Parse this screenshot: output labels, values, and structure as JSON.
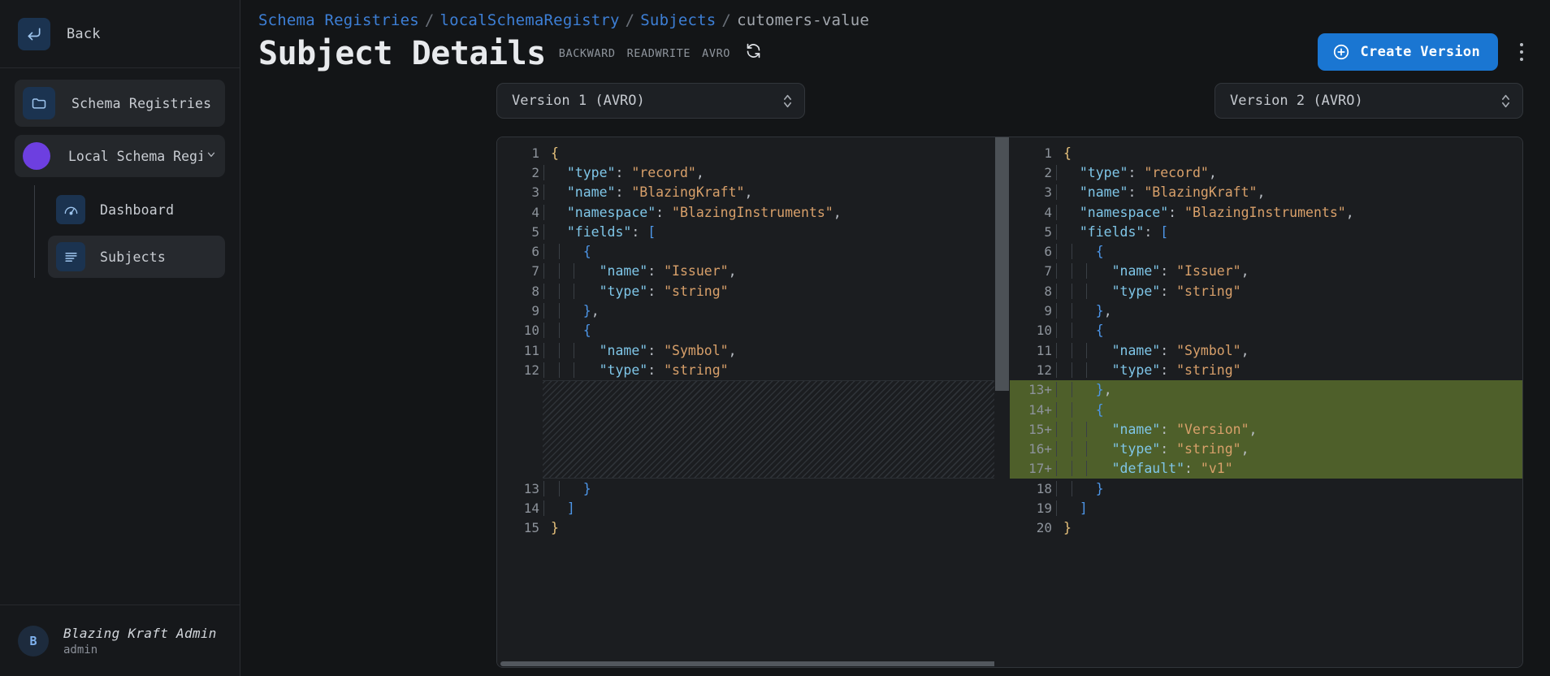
{
  "colors": {
    "accent": "#1a76d2",
    "link": "#3d7fd6",
    "diff_added_bg": "#4e5f2a",
    "registry_dot": "#6d3fe0"
  },
  "sidebar": {
    "back": {
      "label": "Back",
      "icon": "back-arrow-icon"
    },
    "schema_registries": {
      "label": "Schema Registries",
      "icon": "folder-icon"
    },
    "registry": {
      "label": "Local Schema Regi…",
      "icon": "registry-dot-icon",
      "chevron": "⌄"
    },
    "nav": [
      {
        "label": "Dashboard",
        "icon": "gauge-icon",
        "active": false
      },
      {
        "label": "Subjects",
        "icon": "list-icon",
        "active": true
      }
    ],
    "user": {
      "initial": "B",
      "name": "Blazing Kraft Admin",
      "role": "admin"
    }
  },
  "header": {
    "breadcrumb": [
      {
        "text": "Schema Registries",
        "type": "link"
      },
      {
        "text": "localSchemaRegistry",
        "type": "link"
      },
      {
        "text": "Subjects",
        "type": "link"
      },
      {
        "text": "cutomers-value",
        "type": "current"
      }
    ],
    "breadcrumb_separator": "/",
    "title": "Subject Details",
    "badges": [
      "BACKWARD",
      "READWRITE",
      "AVRO"
    ],
    "refresh_icon": "refresh-icon",
    "create_button": {
      "label": "Create Version",
      "icon": "plus-circle-icon"
    },
    "kebab_icon": "more-vertical-icon"
  },
  "version_selects": {
    "left": {
      "value": "Version 1 (AVRO)",
      "icon": "chevron-updown-icon"
    },
    "right": {
      "value": "Version 2 (AVRO)",
      "icon": "chevron-updown-icon"
    }
  },
  "diff": {
    "left": {
      "lines": [
        {
          "n": "1",
          "added": false,
          "indent": 0,
          "tokens": [
            [
              "brace",
              "{"
            ]
          ]
        },
        {
          "n": "2",
          "added": false,
          "indent": 1,
          "tokens": [
            [
              "key",
              "\"type\""
            ],
            [
              "punct",
              ": "
            ],
            [
              "str",
              "\"record\""
            ],
            [
              "punct",
              ","
            ]
          ]
        },
        {
          "n": "3",
          "added": false,
          "indent": 1,
          "tokens": [
            [
              "key",
              "\"name\""
            ],
            [
              "punct",
              ": "
            ],
            [
              "str",
              "\"BlazingKraft\""
            ],
            [
              "punct",
              ","
            ]
          ]
        },
        {
          "n": "4",
          "added": false,
          "indent": 1,
          "tokens": [
            [
              "key",
              "\"namespace\""
            ],
            [
              "punct",
              ": "
            ],
            [
              "str",
              "\"BlazingInstruments\""
            ],
            [
              "punct",
              ","
            ]
          ]
        },
        {
          "n": "5",
          "added": false,
          "indent": 1,
          "tokens": [
            [
              "key",
              "\"fields\""
            ],
            [
              "punct",
              ": "
            ],
            [
              "brace2",
              "["
            ]
          ]
        },
        {
          "n": "6",
          "added": false,
          "indent": 2,
          "tokens": [
            [
              "brace2",
              "{"
            ]
          ]
        },
        {
          "n": "7",
          "added": false,
          "indent": 3,
          "tokens": [
            [
              "key",
              "\"name\""
            ],
            [
              "punct",
              ": "
            ],
            [
              "str",
              "\"Issuer\""
            ],
            [
              "punct",
              ","
            ]
          ]
        },
        {
          "n": "8",
          "added": false,
          "indent": 3,
          "tokens": [
            [
              "key",
              "\"type\""
            ],
            [
              "punct",
              ": "
            ],
            [
              "str",
              "\"string\""
            ]
          ]
        },
        {
          "n": "9",
          "added": false,
          "indent": 2,
          "tokens": [
            [
              "brace2",
              "}"
            ],
            [
              "punct",
              ","
            ]
          ]
        },
        {
          "n": "10",
          "added": false,
          "indent": 2,
          "tokens": [
            [
              "brace2",
              "{"
            ]
          ]
        },
        {
          "n": "11",
          "added": false,
          "indent": 3,
          "tokens": [
            [
              "key",
              "\"name\""
            ],
            [
              "punct",
              ": "
            ],
            [
              "str",
              "\"Symbol\""
            ],
            [
              "punct",
              ","
            ]
          ]
        },
        {
          "n": "12",
          "added": false,
          "indent": 3,
          "tokens": [
            [
              "key",
              "\"type\""
            ],
            [
              "punct",
              ": "
            ],
            [
              "str",
              "\"string\""
            ]
          ]
        },
        {
          "n": "",
          "added": false,
          "indent": 0,
          "tokens": [],
          "filler": true
        },
        {
          "n": "",
          "added": false,
          "indent": 0,
          "tokens": [],
          "filler": true
        },
        {
          "n": "",
          "added": false,
          "indent": 0,
          "tokens": [],
          "filler": true
        },
        {
          "n": "",
          "added": false,
          "indent": 0,
          "tokens": [],
          "filler": true
        },
        {
          "n": "",
          "added": false,
          "indent": 0,
          "tokens": [],
          "filler": true
        },
        {
          "n": "13",
          "added": false,
          "indent": 2,
          "tokens": [
            [
              "brace2",
              "}"
            ]
          ]
        },
        {
          "n": "14",
          "added": false,
          "indent": 1,
          "tokens": [
            [
              "brace2",
              "]"
            ]
          ]
        },
        {
          "n": "15",
          "added": false,
          "indent": 0,
          "tokens": [
            [
              "brace",
              "}"
            ]
          ]
        }
      ]
    },
    "right": {
      "lines": [
        {
          "n": "1",
          "added": false,
          "indent": 0,
          "tokens": [
            [
              "brace",
              "{"
            ]
          ]
        },
        {
          "n": "2",
          "added": false,
          "indent": 1,
          "tokens": [
            [
              "key",
              "\"type\""
            ],
            [
              "punct",
              ": "
            ],
            [
              "str",
              "\"record\""
            ],
            [
              "punct",
              ","
            ]
          ]
        },
        {
          "n": "3",
          "added": false,
          "indent": 1,
          "tokens": [
            [
              "key",
              "\"name\""
            ],
            [
              "punct",
              ": "
            ],
            [
              "str",
              "\"BlazingKraft\""
            ],
            [
              "punct",
              ","
            ]
          ]
        },
        {
          "n": "4",
          "added": false,
          "indent": 1,
          "tokens": [
            [
              "key",
              "\"namespace\""
            ],
            [
              "punct",
              ": "
            ],
            [
              "str",
              "\"BlazingInstruments\""
            ],
            [
              "punct",
              ","
            ]
          ]
        },
        {
          "n": "5",
          "added": false,
          "indent": 1,
          "tokens": [
            [
              "key",
              "\"fields\""
            ],
            [
              "punct",
              ": "
            ],
            [
              "brace2",
              "["
            ]
          ]
        },
        {
          "n": "6",
          "added": false,
          "indent": 2,
          "tokens": [
            [
              "brace2",
              "{"
            ]
          ]
        },
        {
          "n": "7",
          "added": false,
          "indent": 3,
          "tokens": [
            [
              "key",
              "\"name\""
            ],
            [
              "punct",
              ": "
            ],
            [
              "str",
              "\"Issuer\""
            ],
            [
              "punct",
              ","
            ]
          ]
        },
        {
          "n": "8",
          "added": false,
          "indent": 3,
          "tokens": [
            [
              "key",
              "\"type\""
            ],
            [
              "punct",
              ": "
            ],
            [
              "str",
              "\"string\""
            ]
          ]
        },
        {
          "n": "9",
          "added": false,
          "indent": 2,
          "tokens": [
            [
              "brace2",
              "}"
            ],
            [
              "punct",
              ","
            ]
          ]
        },
        {
          "n": "10",
          "added": false,
          "indent": 2,
          "tokens": [
            [
              "brace2",
              "{"
            ]
          ]
        },
        {
          "n": "11",
          "added": false,
          "indent": 3,
          "tokens": [
            [
              "key",
              "\"name\""
            ],
            [
              "punct",
              ": "
            ],
            [
              "str",
              "\"Symbol\""
            ],
            [
              "punct",
              ","
            ]
          ]
        },
        {
          "n": "12",
          "added": false,
          "indent": 3,
          "tokens": [
            [
              "key",
              "\"type\""
            ],
            [
              "punct",
              ": "
            ],
            [
              "str",
              "\"string\""
            ]
          ]
        },
        {
          "n": "13",
          "added": true,
          "indent": 2,
          "tokens": [
            [
              "brace2",
              "}"
            ],
            [
              "punct",
              ","
            ]
          ]
        },
        {
          "n": "14",
          "added": true,
          "indent": 2,
          "tokens": [
            [
              "brace2",
              "{"
            ]
          ]
        },
        {
          "n": "15",
          "added": true,
          "indent": 3,
          "tokens": [
            [
              "key",
              "\"name\""
            ],
            [
              "punct",
              ": "
            ],
            [
              "str",
              "\"Version\""
            ],
            [
              "punct",
              ","
            ]
          ]
        },
        {
          "n": "16",
          "added": true,
          "indent": 3,
          "tokens": [
            [
              "key",
              "\"type\""
            ],
            [
              "punct",
              ": "
            ],
            [
              "str",
              "\"string\""
            ],
            [
              "punct",
              ","
            ]
          ]
        },
        {
          "n": "17",
          "added": true,
          "indent": 3,
          "tokens": [
            [
              "key",
              "\"default\""
            ],
            [
              "punct",
              ": "
            ],
            [
              "str",
              "\"v1\""
            ]
          ]
        },
        {
          "n": "18",
          "added": false,
          "indent": 2,
          "tokens": [
            [
              "brace2",
              "}"
            ]
          ]
        },
        {
          "n": "19",
          "added": false,
          "indent": 1,
          "tokens": [
            [
              "brace2",
              "]"
            ]
          ]
        },
        {
          "n": "20",
          "added": false,
          "indent": 0,
          "tokens": [
            [
              "brace",
              "}"
            ]
          ]
        }
      ]
    },
    "added_marker": "+"
  }
}
